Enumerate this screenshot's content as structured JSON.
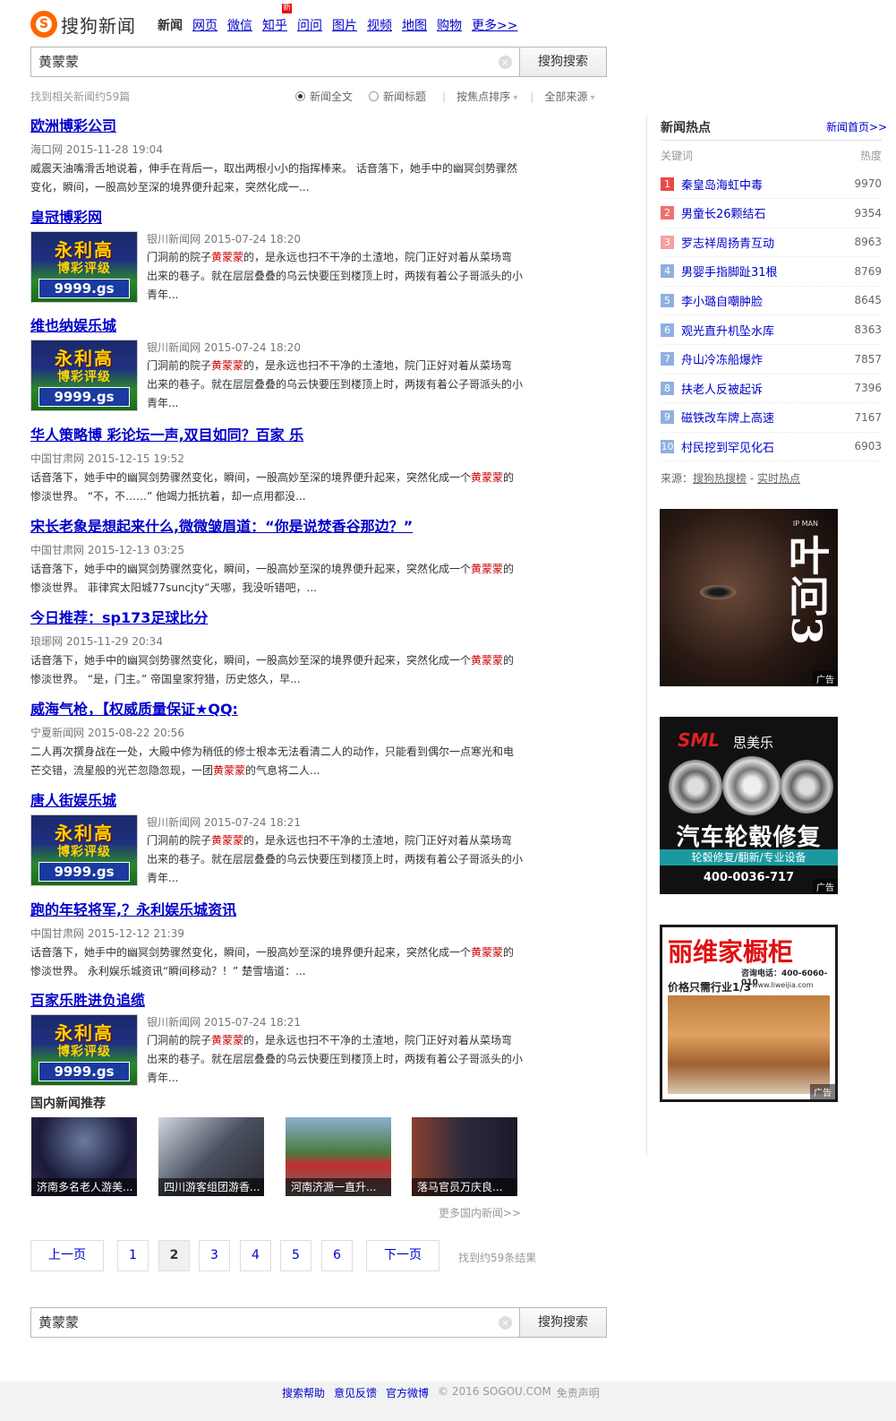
{
  "logo": {
    "text": "搜狗新闻",
    "mark": "S"
  },
  "nav": {
    "items": [
      "新闻",
      "网页",
      "微信",
      "知乎",
      "问问",
      "图片",
      "视频",
      "地图",
      "购物",
      "更多>>"
    ],
    "current": "新闻",
    "new_badge": "新"
  },
  "search": {
    "query": "黄蒙蒙",
    "button": "搜狗搜索",
    "clear_icon": "×"
  },
  "stats": "找到相关新闻约59篇",
  "filters": {
    "opt1": "新闻全文",
    "opt2": "新闻标题",
    "sort": "按焦点排序",
    "source": "全部来源"
  },
  "results": [
    {
      "title": "欧洲博彩公司",
      "meta": "海口网 2015-11-28 19:04",
      "snippet": "威震天油嘴滑舌地说着，伸手在背后一，取出两根小小的指挥棒来。 话音落下，她手中的幽冥剑势骤然变化，瞬间，一股高妙至深的境界便升起来，突然化成一..."
    },
    {
      "title": "皇冠博彩网",
      "meta": "银川新闻网 2015-07-24 18:20",
      "snippet_a": "门洞前的院子",
      "snippet_em": "黄蒙蒙",
      "snippet_b": "的，是永远也扫不干净的土渣地，院门正好对着从菜场弯出来的巷子。就在层层叠叠的乌云快要压到楼顶上时，两拨有着公子哥派头的小青年..."
    },
    {
      "title": "维也纳娱乐城",
      "meta": "银川新闻网 2015-07-24 18:20",
      "snippet_a": "门洞前的院子",
      "snippet_em": "黄蒙蒙",
      "snippet_b": "的，是永远也扫不干净的土渣地，院门正好对着从菜场弯出来的巷子。就在层层叠叠的乌云快要压到楼顶上时，两拨有着公子哥派头的小青年..."
    },
    {
      "title": "华人策略博 彩论坛一声,双目如同？百家 乐",
      "meta": "中国甘肃网 2015-12-15 19:52",
      "snippet_a": "话音落下，她手中的幽冥剑势骤然变化，瞬间，一股高妙至深的境界便升起来，突然化成一个",
      "snippet_em": "黄蒙蒙",
      "snippet_b": "的惨淡世界。 “不，不……” 他竭力抵抗着，却一点用都没..."
    },
    {
      "title": "宋长老象是想起来什么,微微皱眉道：“你是说焚香谷那边？”",
      "meta": "中国甘肃网 2015-12-13 03:25",
      "snippet_a": "话音落下，她手中的幽冥剑势骤然变化，瞬间，一股高妙至深的境界便升起来，突然化成一个",
      "snippet_em": "黄蒙蒙",
      "snippet_b": "的惨淡世界。 菲律宾太阳城77suncjty“天哪，我没听错吧，..."
    },
    {
      "title": "今日推荐：sp173足球比分",
      "meta": "琅琊网 2015-11-29 20:34",
      "snippet_a": "话音落下，她手中的幽冥剑势骤然变化，瞬间，一股高妙至深的境界便升起来，突然化成一个",
      "snippet_em": "黄蒙蒙",
      "snippet_b": "的惨淡世界。 “是，门主。” 帝国皇家狩猎，历史悠久，早..."
    },
    {
      "title": "威海气枪，【权威质量保证★QQ:",
      "meta": "宁夏新闻网 2015-08-22 20:56",
      "snippet_a": "二人再次撰身战在一处，大殿中修为稍低的修士根本无法看清二人的动作，只能看到偶尔一点寒光和电芒交错，流星般的光芒忽隐忽现，一团",
      "snippet_em": "黄蒙蒙",
      "snippet_b": "的气息将二人..."
    },
    {
      "title": "唐人街娱乐城",
      "meta": "银川新闻网 2015-07-24 18:21",
      "snippet_a": "门洞前的院子",
      "snippet_em": "黄蒙蒙",
      "snippet_b": "的，是永远也扫不干净的土渣地，院门正好对着从菜场弯出来的巷子。就在层层叠叠的乌云快要压到楼顶上时，两拨有着公子哥派头的小青年..."
    },
    {
      "title": "跑的年轻将军,？永利娱乐城资讯",
      "meta": "中国甘肃网 2015-12-12 21:39",
      "snippet_a": "话音落下，她手中的幽冥剑势骤然变化，瞬间，一股高妙至深的境界便升起来，突然化成一个",
      "snippet_em": "黄蒙蒙",
      "snippet_b": "的惨淡世界。 永利娱乐城资讯“瞬间移动？！” 楚雪墙道：..."
    },
    {
      "title": "百家乐胜进负追缆",
      "meta": "银川新闻网 2015-07-24 18:21",
      "snippet_a": "门洞前的院子",
      "snippet_em": "黄蒙蒙",
      "snippet_b": "的，是永远也扫不干净的土渣地，院门正好对着从菜场弯出来的巷子。就在层层叠叠的乌云快要压到楼顶上时，两拨有着公子哥派头的小青年..."
    }
  ],
  "thumb_ad": {
    "line1": "永利高",
    "line2": "博彩评级",
    "line3": "9999.gs"
  },
  "recommend": {
    "title": "国内新闻推荐",
    "items": [
      "济南多名老人游美...",
      "四川游客组团游香...",
      "河南济源一直升...",
      "落马官员万庆良..."
    ],
    "more": "更多国内新闻>>"
  },
  "pagination": {
    "prev": "上一页",
    "pages": [
      "1",
      "2",
      "3",
      "4",
      "5",
      "6"
    ],
    "current": "2",
    "next": "下一页",
    "count": "找到约59条结果"
  },
  "footer": {
    "help": "搜索帮助",
    "feedback": "意见反馈",
    "weibo": "官方微博",
    "copyright": "© 2016 SOGOU.COM",
    "disclaimer": "免责声明"
  },
  "hot": {
    "title": "新闻热点",
    "home_link": "新闻首页>>",
    "col_keyword": "关键词",
    "col_heat": "热度",
    "items": [
      {
        "rank": "1",
        "keyword": "秦皇岛海虹中毒",
        "heat": "9970",
        "color": "#e84a4a"
      },
      {
        "rank": "2",
        "keyword": "男童长26颗结石",
        "heat": "9354",
        "color": "#f07070"
      },
      {
        "rank": "3",
        "keyword": "罗志祥周扬青互动",
        "heat": "8963",
        "color": "#f5a0a0"
      },
      {
        "rank": "4",
        "keyword": "男婴手指脚趾31根",
        "heat": "8769",
        "color": "#8fb0e0"
      },
      {
        "rank": "5",
        "keyword": "李小璐自嘲肿脸",
        "heat": "8645",
        "color": "#8fb0e0"
      },
      {
        "rank": "6",
        "keyword": "观光直升机坠水库",
        "heat": "8363",
        "color": "#8fb0e0"
      },
      {
        "rank": "7",
        "keyword": "舟山冷冻船爆炸",
        "heat": "7857",
        "color": "#8fb0e0"
      },
      {
        "rank": "8",
        "keyword": "扶老人反被起诉",
        "heat": "7396",
        "color": "#8fb0e0"
      },
      {
        "rank": "9",
        "keyword": "磁铁改车牌上高速",
        "heat": "7167",
        "color": "#8fb0e0"
      },
      {
        "rank": "10",
        "keyword": "村民挖到罕见化石",
        "heat": "6903",
        "color": "#8fb0e0"
      }
    ],
    "source_label": "来源：",
    "source_link1": "搜狗热搜榜",
    "source_sep": "-",
    "source_link2": "实时热点"
  },
  "ads": {
    "tag": "广告",
    "ad1": {
      "title": "叶问3",
      "sub": "IP MAN"
    },
    "ad2": {
      "brand": "SML",
      "brand_cn": "思美乐",
      "headline": "汽车轮毂修复",
      "sub": "轮毂修复/翻新/专业设备",
      "phone": "400-0036-717"
    },
    "ad3": {
      "headline": "丽维家橱柜",
      "phone": "咨询电话：400-6060-010",
      "sub": "价格只需行业1/3",
      "url": "www.liweijia.com"
    }
  }
}
